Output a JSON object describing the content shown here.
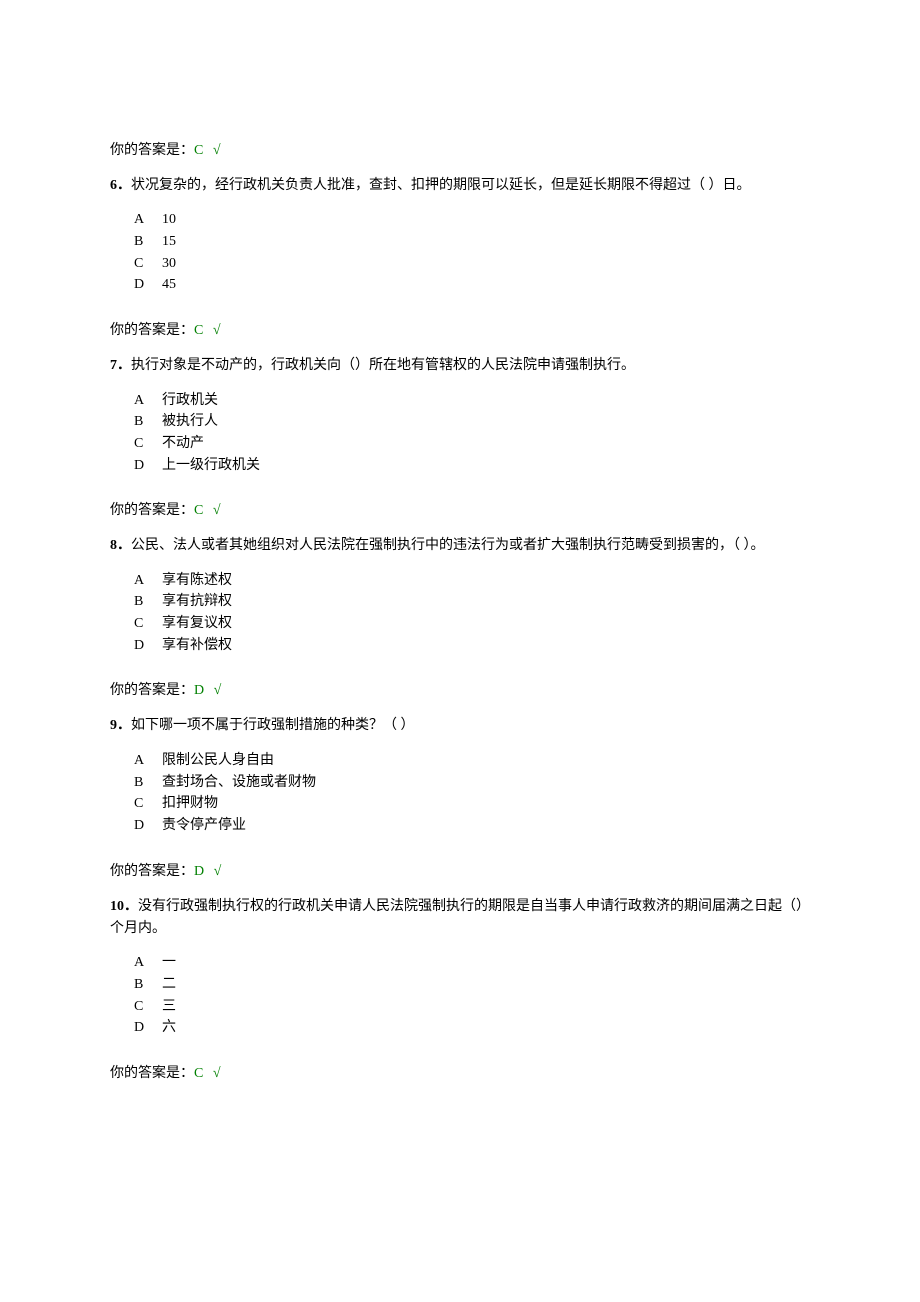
{
  "answer_label": "你的答案是：",
  "check_mark": "√",
  "blocks": [
    {
      "type": "answer",
      "value": "C"
    },
    {
      "type": "question",
      "number": "6．",
      "text": "状况复杂的，经行政机关负责人批准，查封、扣押的期限可以延长，但是延长期限不得超过（ ）日。",
      "options": [
        {
          "letter": "A",
          "text": "10"
        },
        {
          "letter": "B",
          "text": "15"
        },
        {
          "letter": "C",
          "text": "30"
        },
        {
          "letter": "D",
          "text": "45"
        }
      ]
    },
    {
      "type": "answer",
      "value": "C"
    },
    {
      "type": "question",
      "number": "7．",
      "text": "执行对象是不动产的，行政机关向（）所在地有管辖权的人民法院申请强制执行。",
      "options": [
        {
          "letter": "A",
          "text": "行政机关"
        },
        {
          "letter": "B",
          "text": "被执行人"
        },
        {
          "letter": "C",
          "text": "不动产"
        },
        {
          "letter": "D",
          "text": "上一级行政机关"
        }
      ]
    },
    {
      "type": "answer",
      "value": "C"
    },
    {
      "type": "question",
      "number": "8．",
      "text": "公民、法人或者其她组织对人民法院在强制执行中的违法行为或者扩大强制执行范畴受到损害的，（ ）。",
      "options": [
        {
          "letter": "A",
          "text": "享有陈述权"
        },
        {
          "letter": "B",
          "text": "享有抗辩权"
        },
        {
          "letter": "C",
          "text": "享有复议权"
        },
        {
          "letter": "D",
          "text": "享有补偿权"
        }
      ]
    },
    {
      "type": "answer",
      "value": "D"
    },
    {
      "type": "question",
      "number": "9．",
      "text": "如下哪一项不属于行政强制措施的种类？（ ）",
      "options": [
        {
          "letter": "A",
          "text": "限制公民人身自由"
        },
        {
          "letter": "B",
          "text": "查封场合、设施或者财物"
        },
        {
          "letter": "C",
          "text": "扣押财物"
        },
        {
          "letter": "D",
          "text": "责令停产停业"
        }
      ]
    },
    {
      "type": "answer",
      "value": "D"
    },
    {
      "type": "question",
      "number": "10．",
      "text": "没有行政强制执行权的行政机关申请人民法院强制执行的期限是自当事人申请行政救济的期间届满之日起（）个月内。",
      "options": [
        {
          "letter": "A",
          "text": "一"
        },
        {
          "letter": "B",
          "text": "二"
        },
        {
          "letter": "C",
          "text": "三"
        },
        {
          "letter": "D",
          "text": "六"
        }
      ]
    },
    {
      "type": "answer",
      "value": "C"
    }
  ]
}
